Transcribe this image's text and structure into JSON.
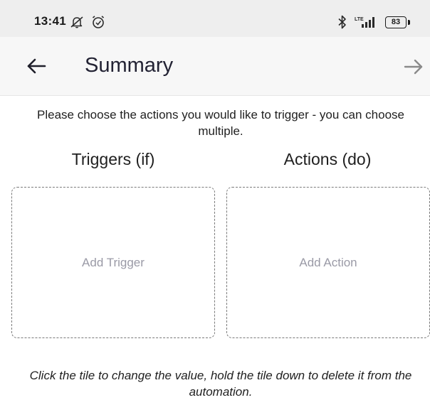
{
  "status_bar": {
    "time": "13:41",
    "battery_level": "83",
    "icons": [
      "notifications-muted-icon",
      "alarm-icon",
      "bluetooth-icon",
      "lte-signal-icon",
      "battery-icon"
    ],
    "network_label": "LTE"
  },
  "app_bar": {
    "title": "Summary",
    "back_icon": "arrow-left-icon",
    "forward_icon": "arrow-right-icon"
  },
  "main": {
    "instructions": "Please choose the actions you would like to trigger - you can choose multiple.",
    "triggers": {
      "heading": "Triggers (if)",
      "tile_label": "Add Trigger"
    },
    "actions": {
      "heading": "Actions (do)",
      "tile_label": "Add Action"
    },
    "footer_hint": "Click the tile to change the value, hold the tile down to delete it from the automation."
  },
  "colors": {
    "status_bar_bg": "#eeeeee",
    "app_bar_bg": "#f7f7f7",
    "tile_border": "#7a7a7a",
    "placeholder_text": "#9a9aa6",
    "forward_arrow": "#8a8a8a"
  }
}
